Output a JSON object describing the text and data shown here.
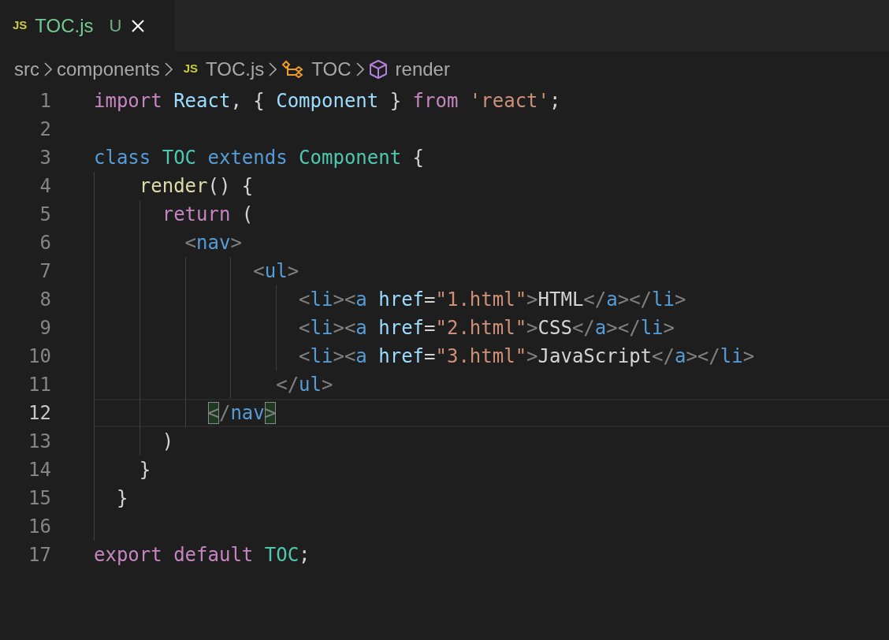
{
  "tabs": [
    {
      "icon_text": "JS",
      "label": "TOC.js",
      "status": "U",
      "selected": true
    }
  ],
  "breadcrumbs": [
    {
      "text": "src"
    },
    {
      "text": "components"
    },
    {
      "kind": "file",
      "icon_text": "JS",
      "text": "TOC.js"
    },
    {
      "kind": "class",
      "text": "TOC"
    },
    {
      "kind": "method",
      "text": "render"
    }
  ],
  "lines": [
    {
      "number": "1",
      "current": false,
      "tokens": [
        {
          "kind": "keyword",
          "text": "import "
        },
        {
          "kind": "variable",
          "text": "React"
        },
        {
          "kind": "plain",
          "text": ", { "
        },
        {
          "kind": "variable",
          "text": "Component"
        },
        {
          "kind": "plain",
          "text": " } "
        },
        {
          "kind": "keyword",
          "text": "from "
        },
        {
          "kind": "string",
          "text": "'react'"
        },
        {
          "kind": "plain",
          "text": ";"
        }
      ]
    },
    {
      "number": "2",
      "current": false
    },
    {
      "number": "3",
      "current": false,
      "tokens": [
        {
          "kind": "storage",
          "text": "class "
        },
        {
          "kind": "class",
          "text": "TOC "
        },
        {
          "kind": "storage",
          "text": "extends "
        },
        {
          "kind": "class",
          "text": "Component"
        },
        {
          "kind": "plain",
          "text": " {"
        }
      ]
    },
    {
      "number": "4",
      "current": false,
      "tokens": [
        {
          "kind": "function",
          "text": "    render"
        },
        {
          "kind": "plain",
          "text": "() {"
        }
      ]
    },
    {
      "number": "5",
      "current": false,
      "tokens": [
        {
          "kind": "keyword",
          "text": "      return"
        },
        {
          "kind": "plain",
          "text": " ("
        }
      ]
    },
    {
      "number": "6",
      "current": false,
      "tokens": [
        {
          "kind": "bracket",
          "text": "        <"
        },
        {
          "kind": "tag",
          "text": "nav"
        },
        {
          "kind": "bracket",
          "text": ">"
        }
      ]
    },
    {
      "number": "7",
      "current": false,
      "tokens": [
        {
          "kind": "bracket",
          "text": "              <"
        },
        {
          "kind": "tag",
          "text": "ul"
        },
        {
          "kind": "bracket",
          "text": ">"
        }
      ]
    },
    {
      "number": "8",
      "current": false,
      "tokens": [
        {
          "kind": "bracket",
          "text": "                  <"
        },
        {
          "kind": "tag",
          "text": "li"
        },
        {
          "kind": "bracket",
          "text": "><"
        },
        {
          "kind": "tag",
          "text": "a "
        },
        {
          "kind": "attr",
          "text": "href"
        },
        {
          "kind": "plain",
          "text": "="
        },
        {
          "kind": "string",
          "text": "\"1.html\""
        },
        {
          "kind": "bracket",
          "text": ">"
        },
        {
          "kind": "plain",
          "text": "HTML"
        },
        {
          "kind": "bracket",
          "text": "</"
        },
        {
          "kind": "tag",
          "text": "a"
        },
        {
          "kind": "bracket",
          "text": "></"
        },
        {
          "kind": "tag",
          "text": "li"
        },
        {
          "kind": "bracket",
          "text": ">"
        }
      ]
    },
    {
      "number": "9",
      "current": false,
      "tokens": [
        {
          "kind": "bracket",
          "text": "                  <"
        },
        {
          "kind": "tag",
          "text": "li"
        },
        {
          "kind": "bracket",
          "text": "><"
        },
        {
          "kind": "tag",
          "text": "a "
        },
        {
          "kind": "attr",
          "text": "href"
        },
        {
          "kind": "plain",
          "text": "="
        },
        {
          "kind": "string",
          "text": "\"2.html\""
        },
        {
          "kind": "bracket",
          "text": ">"
        },
        {
          "kind": "plain",
          "text": "CSS"
        },
        {
          "kind": "bracket",
          "text": "</"
        },
        {
          "kind": "tag",
          "text": "a"
        },
        {
          "kind": "bracket",
          "text": "></"
        },
        {
          "kind": "tag",
          "text": "li"
        },
        {
          "kind": "bracket",
          "text": ">"
        }
      ]
    },
    {
      "number": "10",
      "current": false,
      "tokens": [
        {
          "kind": "bracket",
          "text": "                  <"
        },
        {
          "kind": "tag",
          "text": "li"
        },
        {
          "kind": "bracket",
          "text": "><"
        },
        {
          "kind": "tag",
          "text": "a "
        },
        {
          "kind": "attr",
          "text": "href"
        },
        {
          "kind": "plain",
          "text": "="
        },
        {
          "kind": "string",
          "text": "\"3.html\""
        },
        {
          "kind": "bracket",
          "text": ">"
        },
        {
          "kind": "plain",
          "text": "JavaScript"
        },
        {
          "kind": "bracket",
          "text": "</"
        },
        {
          "kind": "tag",
          "text": "a"
        },
        {
          "kind": "bracket",
          "text": "></"
        },
        {
          "kind": "tag",
          "text": "li"
        },
        {
          "kind": "bracket",
          "text": ">"
        }
      ]
    },
    {
      "number": "11",
      "current": false,
      "tokens": [
        {
          "kind": "bracket",
          "text": "                </"
        },
        {
          "kind": "tag",
          "text": "ul"
        },
        {
          "kind": "bracket",
          "text": ">"
        }
      ]
    },
    {
      "number": "12",
      "current": true,
      "tokens": [
        {
          "kind": "bracket",
          "text": "          <",
          "matched": true
        },
        {
          "kind": "bracket",
          "text": "/"
        },
        {
          "kind": "tag",
          "text": "nav"
        },
        {
          "kind": "bracket",
          "text": ">",
          "matched": true
        }
      ]
    },
    {
      "number": "13",
      "current": false,
      "tokens": [
        {
          "kind": "plain",
          "text": "      )"
        }
      ]
    },
    {
      "number": "14",
      "current": false,
      "tokens": [
        {
          "kind": "plain",
          "text": "    }"
        }
      ]
    },
    {
      "number": "15",
      "current": false,
      "tokens": [
        {
          "kind": "plain",
          "text": "  }"
        }
      ]
    },
    {
      "number": "16",
      "current": false
    },
    {
      "number": "17",
      "current": false,
      "tokens": [
        {
          "kind": "keyword",
          "text": "export "
        },
        {
          "kind": "keyword",
          "text": "default "
        },
        {
          "kind": "class",
          "text": "TOC"
        },
        {
          "kind": "plain",
          "text": ";"
        }
      ]
    }
  ]
}
